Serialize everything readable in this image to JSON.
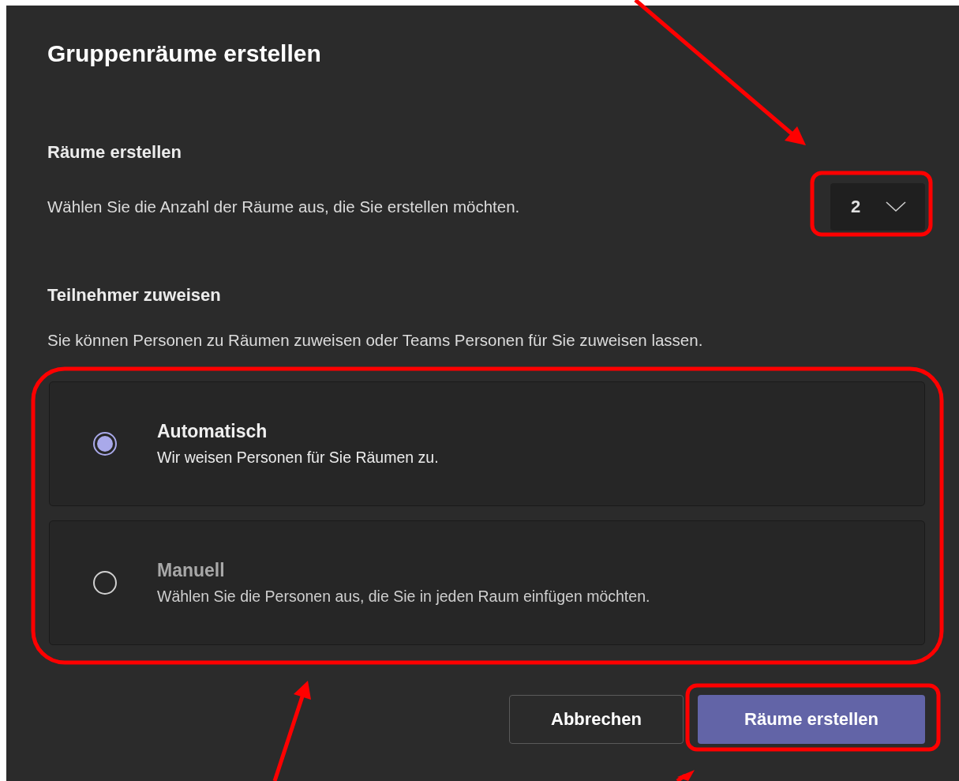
{
  "dialog": {
    "title": "Gruppenräume erstellen"
  },
  "rooms": {
    "heading": "Räume erstellen",
    "description": "Wählen Sie die Anzahl der Räume aus, die Sie erstellen möchten.",
    "dropdown": {
      "value": "2"
    }
  },
  "assign": {
    "heading": "Teilnehmer zuweisen",
    "description": "Sie können Personen zu Räumen zuweisen oder Teams Personen für Sie zuweisen lassen.",
    "options": [
      {
        "title": "Automatisch",
        "description": "Wir weisen Personen für Sie Räumen zu.",
        "selected": true
      },
      {
        "title": "Manuell",
        "description": "Wählen Sie die Personen aus, die Sie in jeden Raum einfügen möchten.",
        "selected": false
      }
    ]
  },
  "buttons": [
    {
      "label": "Abbrechen",
      "kind": "secondary"
    },
    {
      "label": "Räume erstellen",
      "kind": "primary"
    }
  ]
}
